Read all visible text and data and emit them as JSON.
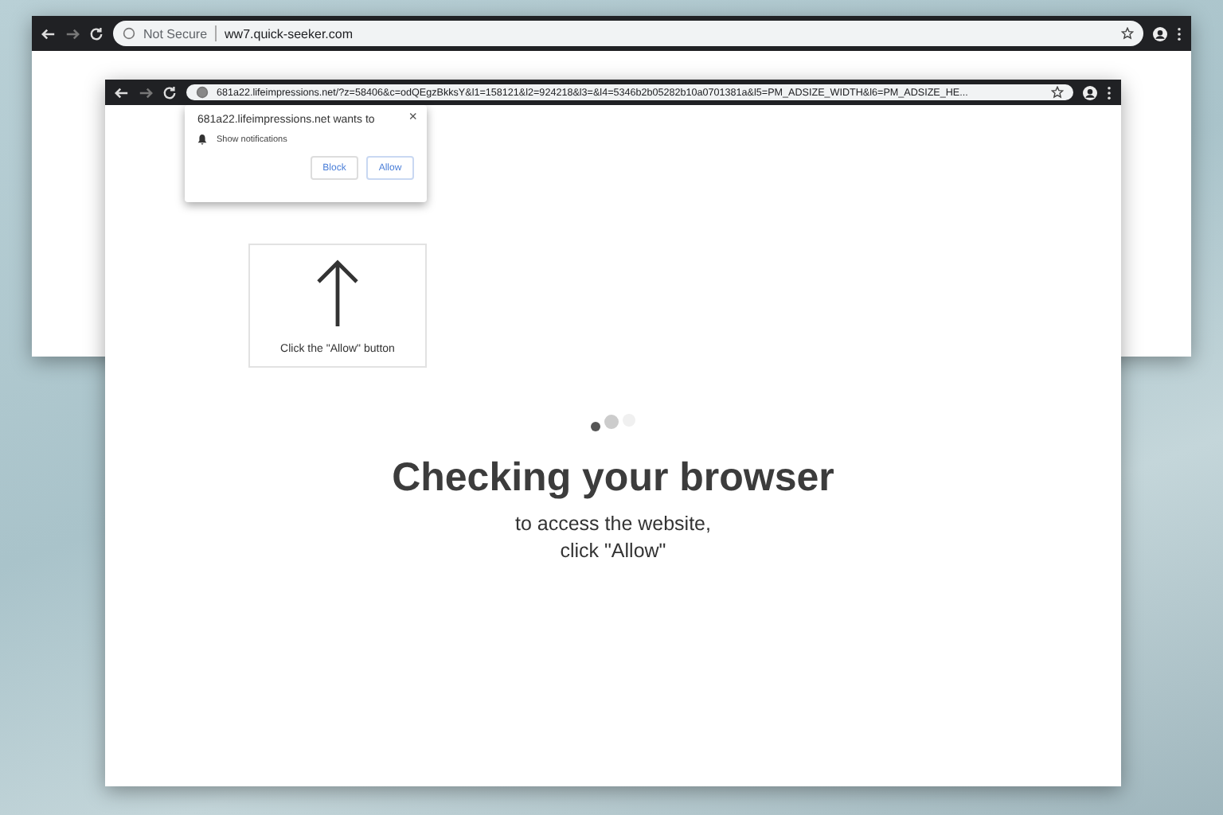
{
  "back_window": {
    "address_bar": {
      "security": "Not Secure",
      "url": "ww7.quick-seeker.com"
    }
  },
  "front_window": {
    "address_bar": {
      "url": "681a22.lifeimpressions.net/?z=58406&c=odQEgzBkksY&l1=158121&l2=924218&l3=&l4=5346b2b05282b10a0701381a&l5=PM_ADSIZE_WIDTH&l6=PM_ADSIZE_HE..."
    },
    "permission_popup": {
      "title": "681a22.lifeimpressions.net wants to",
      "close": "×",
      "permission": "Show notifications",
      "buttons": [
        {
          "label": "Block",
          "kind": "block"
        },
        {
          "label": "Allow",
          "kind": "allow"
        }
      ]
    },
    "hint_card": {
      "caption": "Click the \"Allow\" button"
    },
    "heading": "Checking your browser",
    "subtext": [
      "to access the website,",
      "click \"Allow\""
    ]
  }
}
